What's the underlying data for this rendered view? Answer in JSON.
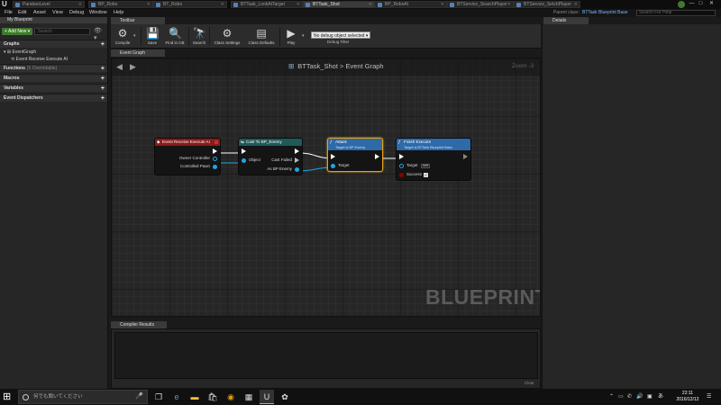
{
  "titlebar": {
    "logo": "U",
    "tabs": [
      {
        "label": "ParatianLevel",
        "active": false
      },
      {
        "label": "BP_Robo",
        "active": false
      },
      {
        "label": "BT_Robo",
        "active": false
      },
      {
        "label": "BTTask_LookAtTarget",
        "active": false
      },
      {
        "label": "BTTask_Shot",
        "active": true
      },
      {
        "label": "BP_RoboAI",
        "active": false
      },
      {
        "label": "BTService_SearchPlayer",
        "active": false
      },
      {
        "label": "BTService_SetchPlayer",
        "active": false
      }
    ],
    "window_buttons": [
      "—",
      "□",
      "✕"
    ]
  },
  "menubar": {
    "items": [
      "File",
      "Edit",
      "Asset",
      "View",
      "Debug",
      "Window",
      "Help"
    ],
    "parent_class_label": "Parent class:",
    "parent_class_value": "BTTask Blueprint Base",
    "search_placeholder": "Search For Help"
  },
  "left_panel": {
    "tab_label": "My Blueprint",
    "add_new": "+ Add New ▾",
    "search_placeholder": "Search",
    "graphs_header": "Graphs",
    "graph_items": [
      "EventGraph",
      "Event Receive Execute AI"
    ],
    "functions_header": "Functions",
    "functions_count": "(5 Overridable)",
    "macros_header": "Macros",
    "variables_header": "Variables",
    "dispatchers_header": "Event Dispatchers"
  },
  "toolbar": {
    "tab_label": "Toolbar",
    "buttons": [
      {
        "label": "Compile",
        "icon": "⚙"
      },
      {
        "label": "Save",
        "icon": "💾"
      },
      {
        "label": "Find in CB",
        "icon": "🔍"
      },
      {
        "label": "Search",
        "icon": "🔭"
      },
      {
        "label": "Class Settings",
        "icon": "⚙"
      },
      {
        "label": "Class Defaults",
        "icon": "▤"
      },
      {
        "label": "Play",
        "icon": "▶"
      }
    ],
    "debug_select": "No debug object selected ▾",
    "debug_label": "Debug Filter"
  },
  "graph": {
    "tab_label": "Event Graph",
    "title": "BTTask_Shot",
    "title_sep": ">",
    "subtitle": "Event Graph",
    "zoom": "Zoom -3",
    "watermark": "BLUEPRINT",
    "nodes": {
      "event": {
        "title": "Event Receive Execute AI",
        "pins": [
          "Owner Controller",
          "Controlled Pawn"
        ],
        "color": "#8b1a1a"
      },
      "cast": {
        "title": "Cast To BP_Enemy",
        "pins_in": [
          "Object"
        ],
        "pins_out": [
          "Cast Failed",
          "As BP Enemy"
        ],
        "color": "#1f5a5a"
      },
      "attack": {
        "title": "Attack",
        "subtitle": "Target is BP Enemy",
        "pins": [
          "Target"
        ],
        "color": "#2e6aa8"
      },
      "finish": {
        "title": "Finish Execute",
        "subtitle": "Target is BTTask Blueprint Base",
        "pins": [
          "Target",
          "Success"
        ],
        "self_value": "self",
        "color": "#2e6aa8"
      }
    }
  },
  "compiler": {
    "tab_label": "Compiler Results",
    "clear": "Clear"
  },
  "details": {
    "tab_label": "Details"
  },
  "taskbar": {
    "search_placeholder": "何でも聞いてください",
    "apps": [
      "task-view",
      "edge",
      "explorer",
      "store",
      "chrome",
      "calculator",
      "unreal",
      "other"
    ],
    "time": "22:11",
    "date": "2016/12/12"
  }
}
